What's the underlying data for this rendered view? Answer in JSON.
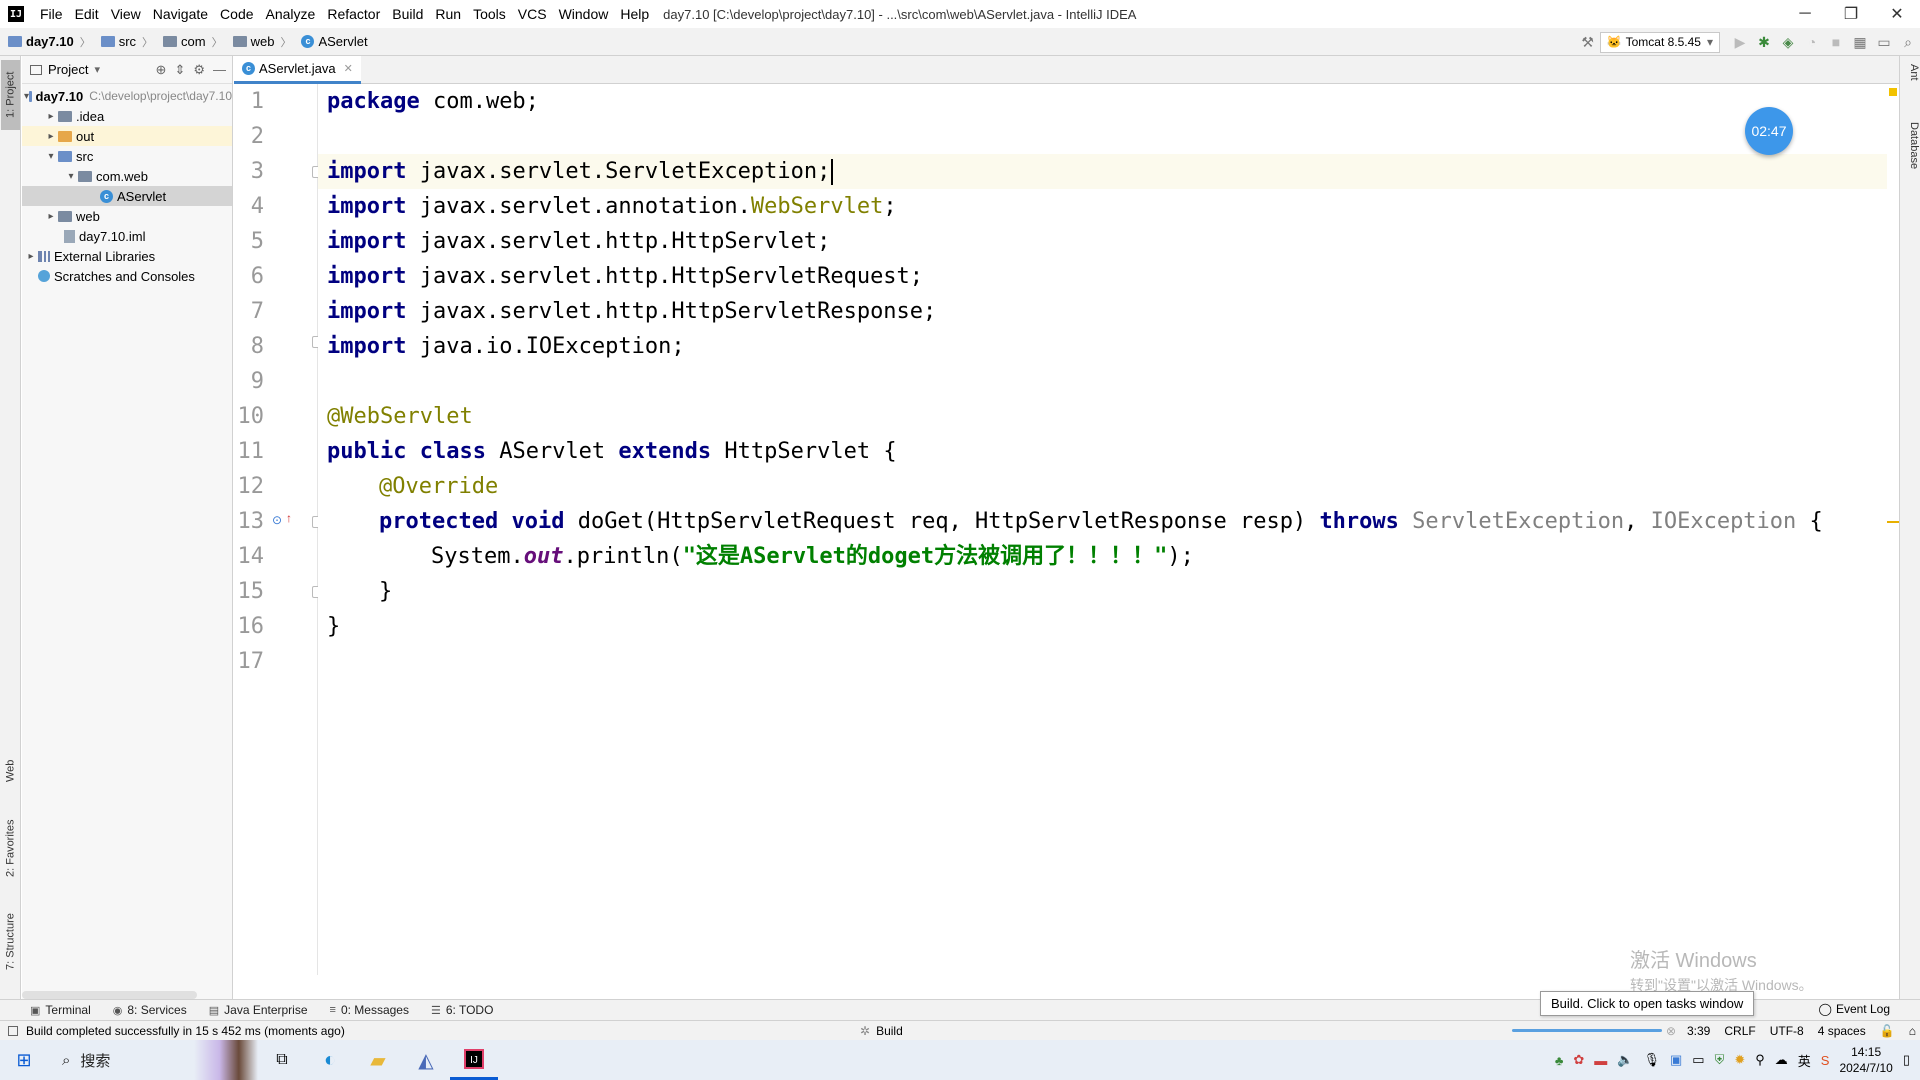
{
  "window": {
    "title": "day7.10 [C:\\develop\\project\\day7.10] - ...\\src\\com\\web\\AServlet.java - IntelliJ IDEA",
    "controls": {
      "minimize": "─",
      "maximize": "❐",
      "close": "✕"
    }
  },
  "menu": [
    "File",
    "Edit",
    "View",
    "Navigate",
    "Code",
    "Analyze",
    "Refactor",
    "Build",
    "Run",
    "Tools",
    "VCS",
    "Window",
    "Help"
  ],
  "breadcrumb": [
    "day7.10",
    "src",
    "com",
    "web",
    "AServlet"
  ],
  "run_config": "Tomcat 8.5.45",
  "left_strip": {
    "project": "1: Project",
    "web": "Web",
    "favorites": "2: Favorites",
    "structure": "7: Structure"
  },
  "right_strip": {
    "ant": "Ant",
    "database": "Database"
  },
  "project_panel": {
    "header": "Project",
    "tree": [
      {
        "label": "day7.10",
        "hint": "C:\\develop\\project\\day7.10"
      },
      {
        "label": ".idea"
      },
      {
        "label": "out"
      },
      {
        "label": "src"
      },
      {
        "label": "com.web"
      },
      {
        "label": "AServlet"
      },
      {
        "label": "web"
      },
      {
        "label": "day7.10.iml"
      },
      {
        "label": "External Libraries"
      },
      {
        "label": "Scratches and Consoles"
      }
    ]
  },
  "editor": {
    "tab": "AServlet.java",
    "line_numbers": [
      "1",
      "2",
      "3",
      "4",
      "5",
      "6",
      "7",
      "8",
      "9",
      "10",
      "11",
      "12",
      "13",
      "14",
      "15",
      "16",
      "17"
    ],
    "current_line": 3,
    "code": {
      "l1_kw": "package",
      "l1_rest": " com.web;",
      "import_kw": "import",
      "l3": " javax.servlet.ServletException;",
      "l4a": " javax.servlet.annotation.",
      "l4b": "WebServlet",
      "l4c": ";",
      "l5": " javax.servlet.http.HttpServlet;",
      "l6": " javax.servlet.http.HttpServletRequest;",
      "l7": " javax.servlet.http.HttpServletResponse;",
      "l8": " java.io.IOException;",
      "l10": "@WebServlet",
      "l11_public": "public",
      "l11_class": "class",
      "l11_name": " AServlet ",
      "l11_extends": "extends",
      "l11_rest": " HttpServlet {",
      "l12": "@Override",
      "l13_protected": "protected",
      "l13_void": "void",
      "l13_mid": " doGet(HttpServletRequest req, HttpServletResponse resp) ",
      "l13_throws": "throws",
      "l13_ex1": "ServletException",
      "l13_comma": ", ",
      "l13_ex2": "IOException",
      "l13_end": " {",
      "l14_a": "System.",
      "l14_out": "out",
      "l14_b": ".println(",
      "l14_str": "\"这是AServlet的doget方法被调用了！！！！\"",
      "l14_c": ");",
      "l15": "}",
      "l16": "}"
    }
  },
  "timer": "02:47",
  "watermark": {
    "line1": "激活 Windows",
    "line2": "转到\"设置\"以激活 Windows。"
  },
  "tool_tabs": [
    "Terminal",
    "8: Services",
    "Java Enterprise",
    "0: Messages",
    "6: TODO"
  ],
  "event_log": "Event Log",
  "tooltip": "Build. Click to open tasks window",
  "status": {
    "message": "Build completed successfully in 15 s 452 ms (moments ago)",
    "build": "Build",
    "position": "3:39",
    "line_sep": "CRLF",
    "encoding": "UTF-8",
    "indent": "4 spaces"
  },
  "taskbar": {
    "search": "搜索",
    "ime": "英",
    "time": "14:15",
    "date": "2024/7/10"
  }
}
